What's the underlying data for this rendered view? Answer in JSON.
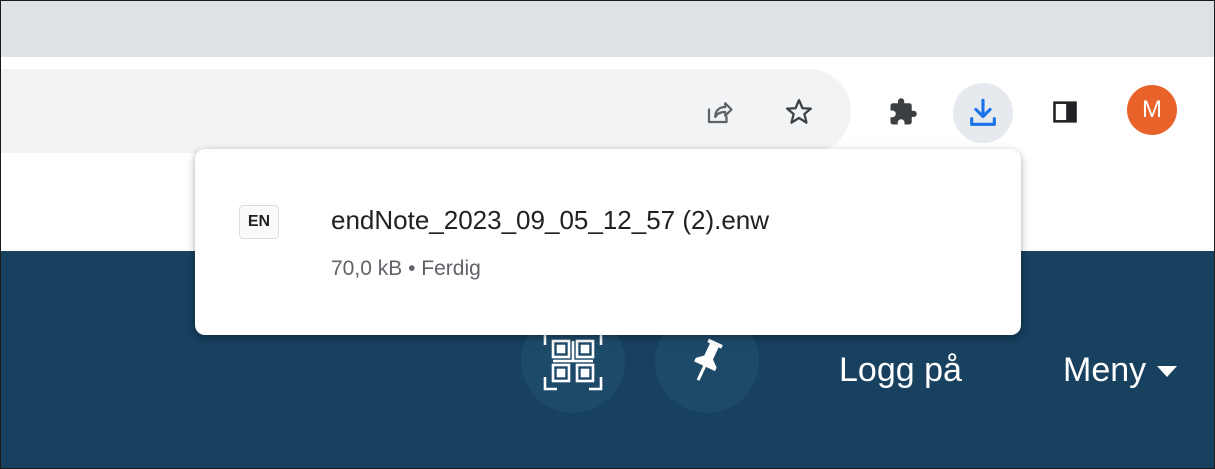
{
  "toolbar": {
    "icons": [
      "share-icon",
      "star-icon",
      "puzzle-icon",
      "download-icon",
      "side-panel-icon"
    ],
    "avatar_initial": "M",
    "avatar_color": "#e8622a",
    "download_icon_color": "#1a73e8"
  },
  "download_bubble": {
    "file_type_label": "EN",
    "file_name": "endNote_2023_09_05_12_57 (2).enw",
    "size": "70,0 kB",
    "separator": "•",
    "status": "Ferdig"
  },
  "page_nav": {
    "background_color": "#17415f",
    "login_label": "Logg på",
    "menu_label": "Meny",
    "icons": [
      "qr-code-icon",
      "pin-icon",
      "caret-down-icon"
    ]
  }
}
